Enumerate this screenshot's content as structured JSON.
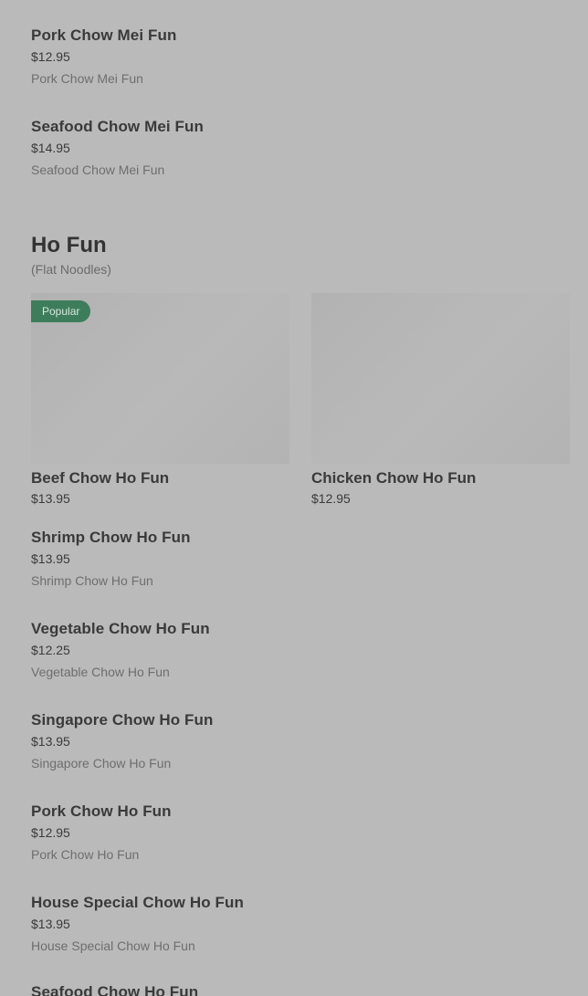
{
  "top_items": [
    {
      "name": "Pork Chow Mei Fun",
      "price": "$12.95",
      "description": "Pork Chow Mei Fun"
    },
    {
      "name": "Seafood Chow Mei Fun",
      "price": "$14.95",
      "description": "Seafood Chow Mei Fun"
    }
  ],
  "section": {
    "title": "Ho Fun",
    "subtitle": "(Flat Noodles)"
  },
  "featured": [
    {
      "badge": "Popular",
      "name": "Beef Chow Ho Fun",
      "price": "$13.95"
    },
    {
      "badge": "",
      "name": "Chicken Chow Ho Fun",
      "price": "$12.95"
    }
  ],
  "items": [
    {
      "name": "Shrimp Chow Ho Fun",
      "price": "$13.95",
      "description": "Shrimp Chow Ho Fun"
    },
    {
      "name": "Vegetable Chow Ho Fun",
      "price": "$12.25",
      "description": "Vegetable Chow Ho Fun"
    },
    {
      "name": "Singapore Chow Ho Fun",
      "price": "$13.95",
      "description": "Singapore Chow Ho Fun"
    },
    {
      "name": "Pork Chow Ho Fun",
      "price": "$12.95",
      "description": "Pork Chow Ho Fun"
    },
    {
      "name": "House Special Chow Ho Fun",
      "price": "$13.95",
      "description": "House Special Chow Ho Fun"
    },
    {
      "name": "Seafood Chow Ho Fun"
    }
  ],
  "colors": {
    "overlay_background": "#bababa",
    "badge_background": "#3e7d5b"
  }
}
